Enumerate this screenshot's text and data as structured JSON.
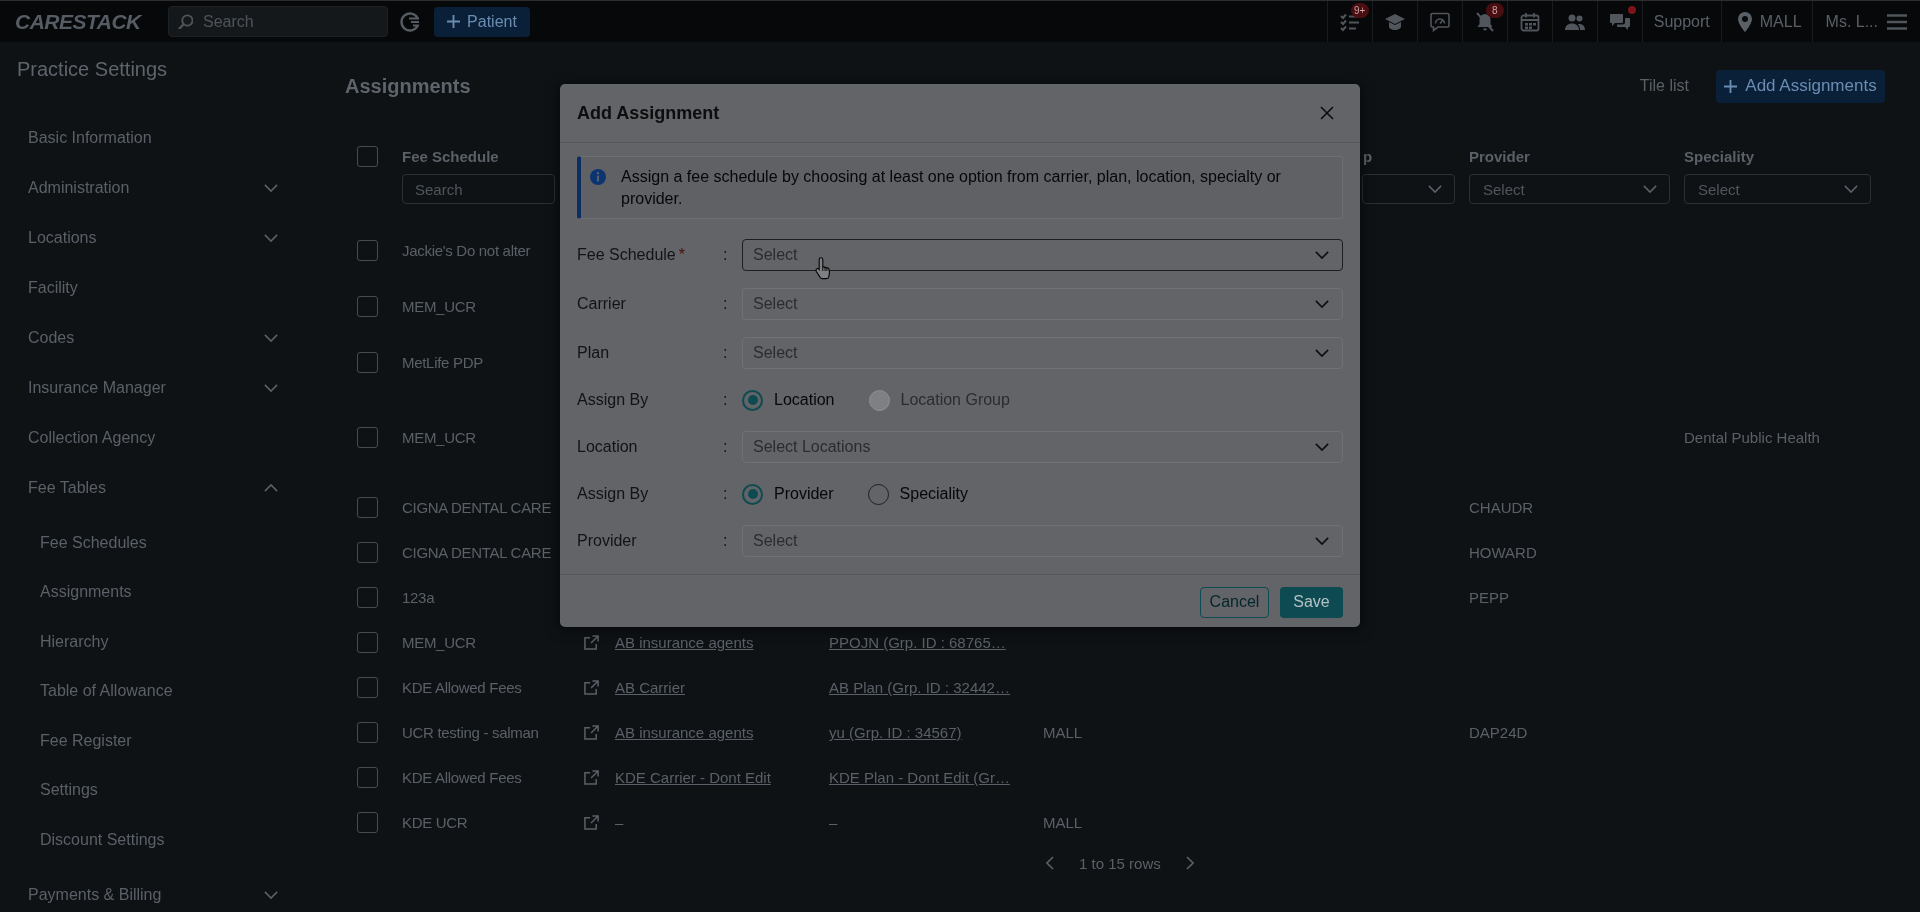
{
  "top_bar": {
    "logo": "CARESTACK",
    "search_placeholder": "Search",
    "patient_button": "Patient",
    "tasks_badge": "9+",
    "alerts_badge": "8",
    "chat_unread": true,
    "support": "Support",
    "location": "MALL",
    "user": "Ms. L..."
  },
  "sidebar": {
    "title": "Practice Settings",
    "items": [
      {
        "kind": "link",
        "label": "Basic Information"
      },
      {
        "kind": "group",
        "label": "Administration",
        "expanded": false
      },
      {
        "kind": "group",
        "label": "Locations",
        "expanded": false
      },
      {
        "kind": "link",
        "label": "Facility"
      },
      {
        "kind": "group",
        "label": "Codes",
        "expanded": false
      },
      {
        "kind": "group",
        "label": "Insurance Manager",
        "expanded": false
      },
      {
        "kind": "link",
        "label": "Collection Agency"
      },
      {
        "kind": "group",
        "label": "Fee Tables",
        "expanded": true,
        "children": [
          {
            "label": "Fee Schedules"
          },
          {
            "label": "Assignments"
          },
          {
            "label": "Hierarchy"
          },
          {
            "label": "Table of Allowance"
          },
          {
            "label": "Fee Register"
          },
          {
            "label": "Settings"
          },
          {
            "label": "Discount Settings"
          }
        ]
      },
      {
        "kind": "group",
        "label": "Payments & Billing",
        "expanded": false
      }
    ]
  },
  "page": {
    "title": "Assignments",
    "view_link": "Tile list",
    "add_button": "Add Assignments"
  },
  "table": {
    "all_checked": false,
    "columns": [
      {
        "label": "Fee Schedule",
        "filter": {
          "kind": "search",
          "placeholder": "Search"
        }
      },
      {
        "label": "p",
        "filter": {
          "kind": "select"
        }
      },
      {
        "label": "Provider",
        "filter": {
          "kind": "select",
          "placeholder": "Select"
        }
      },
      {
        "label": "Speciality",
        "filter": {
          "kind": "select",
          "placeholder": "Select"
        }
      }
    ],
    "rows": [
      {
        "checked": false,
        "fee_schedule": "Jackie's Do not alter"
      },
      {
        "checked": false,
        "fee_schedule": "MEM_UCR"
      },
      {
        "checked": false,
        "fee_schedule": "MetLife PDP"
      },
      {
        "checked": false,
        "fee_schedule": "MEM_UCR",
        "speciality": "Dental Public Health"
      },
      {
        "checked": false,
        "fee_schedule": "CIGNA DENTAL CARE",
        "provider": "CHAUDR"
      },
      {
        "checked": false,
        "fee_schedule": "CIGNA DENTAL CARE",
        "provider": "HOWARD"
      },
      {
        "checked": false,
        "fee_schedule": "123a",
        "provider": "PEPP"
      },
      {
        "checked": false,
        "fee_schedule": "MEM_UCR",
        "external_link": true,
        "column_4": {
          "text": "AB insurance agents",
          "link": true
        },
        "column_5": {
          "text": "PPOJN (Grp. ID : 68765…",
          "link": true
        }
      },
      {
        "checked": false,
        "fee_schedule": "KDE Allowed Fees",
        "external_link": true,
        "column_4": {
          "text": "AB Carrier",
          "link": true
        },
        "column_5": {
          "text": "AB Plan (Grp. ID : 32442…",
          "link": true
        }
      },
      {
        "checked": false,
        "fee_schedule": "UCR testing - salman",
        "external_link": true,
        "column_4": {
          "text": "AB insurance agents",
          "link": true
        },
        "column_5": {
          "text": "yu (Grp. ID : 34567)",
          "link": true
        },
        "column_6": "MALL",
        "provider": "DAP24D"
      },
      {
        "checked": false,
        "fee_schedule": "KDE Allowed Fees",
        "external_link": true,
        "column_4": {
          "text": "KDE Carrier - Dont Edit",
          "link": true
        },
        "column_5": {
          "text": "KDE Plan - Dont Edit (Gr…",
          "link": true
        }
      },
      {
        "checked": false,
        "fee_schedule": "KDE UCR",
        "external_link": true,
        "column_4": {
          "text": "–",
          "link": false
        },
        "column_5": {
          "text": "–",
          "link": false
        },
        "column_6": "MALL"
      }
    ],
    "pagination": "1 to 15 rows"
  },
  "modal": {
    "title": "Add Assignment",
    "info": "Assign a fee schedule by choosing at least one option from carrier, plan, location, specialty or provider.",
    "fields": [
      {
        "kind": "select",
        "label": "Fee Schedule",
        "required_mark": "*",
        "colon": ":",
        "placeholder": "Select",
        "hovered": true
      },
      {
        "kind": "select",
        "label": "Carrier",
        "colon": ":",
        "placeholder": "Select",
        "hovered": false
      },
      {
        "kind": "select",
        "label": "Plan",
        "colon": ":",
        "placeholder": "Select",
        "hovered": false
      },
      {
        "kind": "radio",
        "label": "Assign By",
        "colon": ":",
        "options": [
          {
            "label": "Location",
            "selected": true,
            "disabled": false
          },
          {
            "label": "Location Group",
            "selected": false,
            "disabled": true
          }
        ]
      },
      {
        "kind": "select",
        "label": "Location",
        "colon": ":",
        "placeholder": "Select Locations",
        "hovered": false
      },
      {
        "kind": "radio",
        "label": "Assign By",
        "colon": ":",
        "options": [
          {
            "label": "Provider",
            "selected": true,
            "disabled": false
          },
          {
            "label": "Speciality",
            "selected": false,
            "disabled": false
          }
        ]
      },
      {
        "kind": "select",
        "label": "Provider",
        "colon": ":",
        "placeholder": "Select",
        "hovered": false
      }
    ],
    "buttons": [
      {
        "kind": "secondary",
        "label": "Cancel"
      },
      {
        "kind": "primary",
        "label": "Save"
      }
    ]
  }
}
